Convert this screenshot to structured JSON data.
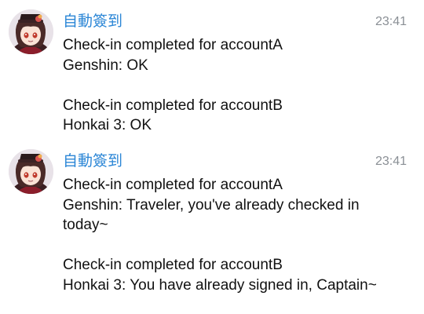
{
  "messages": [
    {
      "sender": "自動簽到",
      "time": "23:41",
      "avatar_icon": "character-avatar-icon",
      "lines": [
        "Check-in completed for accountA",
        "Genshin: OK",
        "",
        "Check-in completed for accountB",
        "Honkai 3: OK"
      ]
    },
    {
      "sender": "自動簽到",
      "time": "23:41",
      "avatar_icon": "character-avatar-icon",
      "lines": [
        "Check-in completed for accountA",
        "Genshin: Traveler, you've already checked in today~",
        "",
        "Check-in completed for accountB",
        "Honkai 3: You have already signed in, Captain~"
      ]
    }
  ],
  "colors": {
    "sender": "#2b86d6",
    "time": "#8a8f95",
    "text": "#111111"
  }
}
